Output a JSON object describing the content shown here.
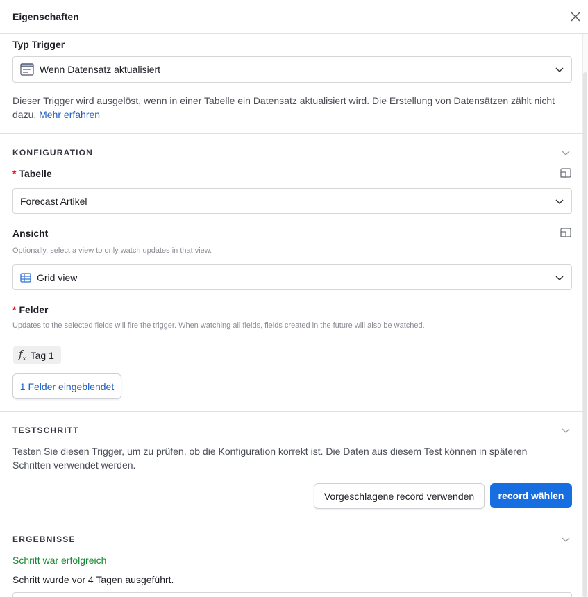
{
  "header": {
    "title": "Eigenschaften"
  },
  "trigger": {
    "label": "Typ Trigger",
    "selected": "Wenn Datensatz aktualisiert",
    "description": "Dieser Trigger wird ausgelöst, wenn in einer Tabelle ein Datensatz aktualisiert wird. Die Erstellung von Datensätzen zählt nicht dazu.",
    "learn_more": "Mehr erfahren"
  },
  "config": {
    "section_title": "KONFIGURATION",
    "table": {
      "required_mark": "*",
      "label": "Tabelle",
      "selected": "Forecast Artikel"
    },
    "view": {
      "label": "Ansicht",
      "hint": "Optionally, select a view to only watch updates in that view.",
      "selected": "Grid view"
    },
    "fields": {
      "required_mark": "*",
      "label": "Felder",
      "hint": "Updates to the selected fields will fire the trigger. When watching all fields, fields created in the future will also be watched.",
      "tags": [
        "Tag 1"
      ],
      "shown_button": "1 Felder eingeblendet"
    }
  },
  "test": {
    "section_title": "TESTSCHRITT",
    "description": "Testen Sie diesen Trigger, um zu prüfen, ob die Konfiguration korrekt ist. Die Daten aus diesem Test können in späteren Schritten verwendet werden.",
    "suggested_button": "Vorgeschlagene record verwenden",
    "choose_button": "record wählen"
  },
  "results": {
    "section_title": "ERGEBNISSE",
    "status": "Schritt war erfolgreich",
    "executed": "Schritt wurde vor 4 Tagen ausgeführt."
  },
  "colors": {
    "accent": "#166ee1",
    "link": "#1f5fbf",
    "success": "#138a2f",
    "required": "#d21c1c"
  }
}
